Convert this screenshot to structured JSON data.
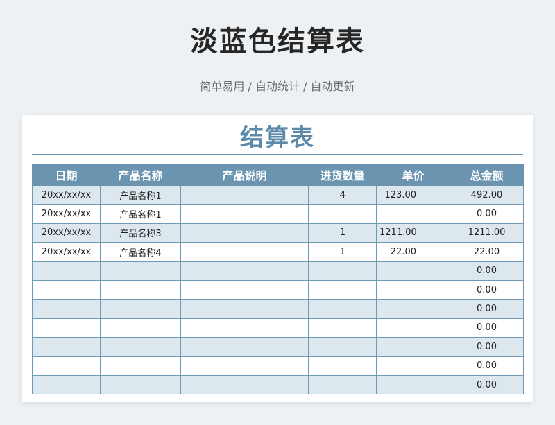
{
  "header": {
    "title": "淡蓝色结算表",
    "subtitle": "简单易用 / 自动统计 / 自动更新"
  },
  "sheet": {
    "title": "结算表",
    "columns": [
      "日期",
      "产品名称",
      "产品说明",
      "进货数量",
      "单价",
      "总金额"
    ],
    "rows": [
      [
        "20xx/xx/xx",
        "产品名称1",
        "",
        "4",
        "123.00",
        "492.00"
      ],
      [
        "20xx/xx/xx",
        "产品名称1",
        "",
        "",
        "",
        "0.00"
      ],
      [
        "20xx/xx/xx",
        "产品名称3",
        "",
        "1",
        "1211.00",
        "1211.00"
      ],
      [
        "20xx/xx/xx",
        "产品名称4",
        "",
        "1",
        "22.00",
        "22.00"
      ],
      [
        "",
        "",
        "",
        "",
        "",
        "0.00"
      ],
      [
        "",
        "",
        "",
        "",
        "",
        "0.00"
      ],
      [
        "",
        "",
        "",
        "",
        "",
        "0.00"
      ],
      [
        "",
        "",
        "",
        "",
        "",
        "0.00"
      ],
      [
        "",
        "",
        "",
        "",
        "",
        "0.00"
      ],
      [
        "",
        "",
        "",
        "",
        "",
        "0.00"
      ],
      [
        "",
        "",
        "",
        "",
        "",
        "0.00"
      ]
    ]
  },
  "colors": {
    "accent": "#6a94b0",
    "title_blue": "#5b8aa8",
    "stripe": "#dde8ee",
    "page_bg": "#eef1f4"
  }
}
